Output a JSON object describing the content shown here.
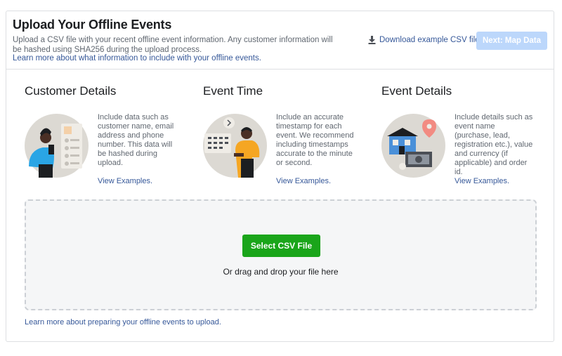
{
  "header": {
    "title": "Upload Your Offline Events",
    "description": "Upload a CSV file with your recent offline event information. Any customer information will be hashed using SHA256 during the upload process.",
    "learn_more": "Learn more about what information to include with your offline events.",
    "download_label": "Download example CSV file",
    "download_icon": "download-icon",
    "next_label": "Next: Map Data"
  },
  "columns": [
    {
      "title": "Customer Details",
      "text": "Include data such as customer name, email address and phone number. This data will be hashed during upload.",
      "link": "View Examples."
    },
    {
      "title": "Event Time",
      "text": "Include an accurate timestamp for each event. We recommend including timestamps accurate to the minute or second.",
      "link": "View Examples."
    },
    {
      "title": "Event Details",
      "text": "Include details such as event name (purchase, lead, registration etc.), value and currency (if applicable) and order id.",
      "link": "View Examples."
    }
  ],
  "dropzone": {
    "button_label": "Select CSV File",
    "drag_text": "Or drag and drop your file here"
  },
  "footer": {
    "link": "Learn more about preparing your offline events to upload."
  },
  "colors": {
    "link": "#365899",
    "next_button_disabled": "#bcd7fb",
    "select_button": "#1aa51a",
    "illustration_bg": "#dcd9d3"
  }
}
